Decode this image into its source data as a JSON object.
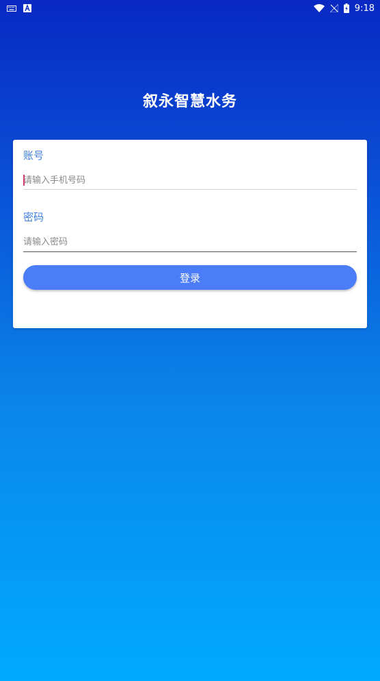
{
  "status_bar": {
    "time": "9:18",
    "icons": {
      "left": [
        "keyboard-icon",
        "a-app-icon"
      ],
      "right": [
        "wifi-icon",
        "no-signal-icon",
        "battery-charging-icon"
      ]
    }
  },
  "app": {
    "title": "叙永智慧水务"
  },
  "login_form": {
    "account": {
      "label": "账号",
      "placeholder": "请输入手机号码",
      "value": ""
    },
    "password": {
      "label": "密码",
      "placeholder": "请输入密码",
      "value": ""
    },
    "submit_label": "登录"
  },
  "colors": {
    "gradient_top": "#0829c2",
    "gradient_bottom": "#00aaff",
    "label": "#3f7fd8",
    "button": "#4a7df7",
    "caret": "#d63a68"
  }
}
